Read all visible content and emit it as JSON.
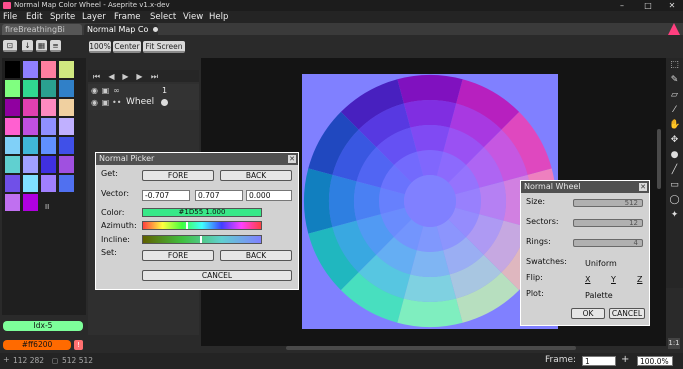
{
  "window": {
    "title": "Normal Map Color Wheel - Aseprite v1.x-dev",
    "minimize": "–",
    "maximize": "□",
    "close": "✕"
  },
  "menu": [
    "File",
    "Edit",
    "Sprite",
    "Layer",
    "Frame",
    "Select",
    "View",
    "Help"
  ],
  "tabs": [
    {
      "label": "fireBreathingBi",
      "active": false
    },
    {
      "label": "Normal Map Co",
      "active": true
    }
  ],
  "toolbar": {
    "zoom_label": "100%",
    "center_label": "Center",
    "fit_label": "Fit Screen"
  },
  "palette": {
    "colors": [
      "#000000",
      "#8f80ff",
      "#ff7fa0",
      "#d0e880",
      "#80ff80",
      "#30d890",
      "#2aa090",
      "#3080c8",
      "#9000a0",
      "#e040b0",
      "#ff8ac0",
      "#f0d0a0",
      "#ff60d0",
      "#c050e0",
      "#9090ff",
      "#c0b0ff",
      "#80d0f8",
      "#40b8d8",
      "#6090ff",
      "#4050e8",
      "#60d0d0",
      "#a0a0ff",
      "#4030e0",
      "#a050e0",
      "#7050e8",
      "#80e0ff",
      "#a080ff",
      "#5070f0",
      "#c070f0",
      "#b000e0"
    ],
    "count_marker": "II",
    "fg_index_label": "Idx-5",
    "fg_index_color": "#7dff9a",
    "bg_hex_label": "#ff6200",
    "bg_color": "#ff6a00",
    "warning_badge": "!"
  },
  "timeline": {
    "layer_name": "Wheel",
    "frame_number": "1"
  },
  "normal_picker": {
    "title": "Normal Picker",
    "get_label": "Get:",
    "fore_label": "FORE",
    "back_label": "BACK",
    "vector_label": "Vector:",
    "vector": [
      "-0.707",
      "0.707",
      "0.000"
    ],
    "color_label": "Color:",
    "color_value": "#1D55 1.000",
    "azimuth_label": "Azimuth:",
    "incline_label": "Incline:",
    "set_label": "Set:",
    "cancel_label": "CANCEL",
    "color_swatch": "#38e888"
  },
  "normal_wheel": {
    "title": "Normal Wheel",
    "size_label": "Size:",
    "size_value": "512",
    "sectors_label": "Sectors:",
    "sectors_value": "12",
    "rings_label": "Rings:",
    "rings_value": "4",
    "swatches_label": "Swatches:",
    "swatches_value": "Uniform",
    "flip_label": "Flip:",
    "flip_options": [
      "X",
      "Y",
      "Z"
    ],
    "plot_label": "Plot:",
    "plot_value": "Palette",
    "ok_label": "OK",
    "cancel_label": "CANCEL"
  },
  "status": {
    "cursor_pos": "112 282",
    "canvas_size": "512 512",
    "frame_label": "Frame:",
    "frame_value": "1",
    "add_label": "+",
    "zoom_value": "100.0%",
    "corner_label": "1:1"
  },
  "tools": [
    "selection-tool-icon",
    "pencil-tool-icon",
    "eraser-tool-icon",
    "eyedropper-tool-icon",
    "hand-tool-icon",
    "move-tool-icon",
    "fill-tool-icon",
    "line-tool-icon",
    "rectangle-tool-icon",
    "ellipse-tool-icon",
    "blur-tool-icon"
  ]
}
